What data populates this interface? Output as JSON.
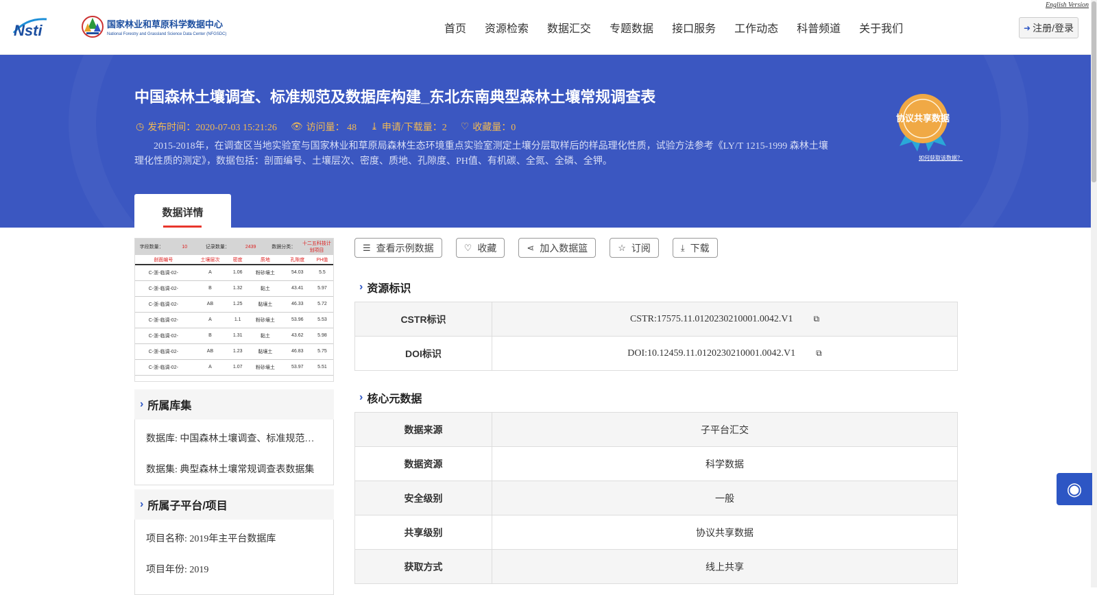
{
  "header": {
    "english_link": "English Version",
    "logo_nsti": "Nsti",
    "logo_center_cn": "国家林业和草原科学数据中心",
    "logo_center_en": "National Forestry and Grassland Science Data Center (NFGSDC)",
    "nav": [
      "首页",
      "资源检索",
      "数据汇交",
      "专题数据",
      "接口服务",
      "工作动态",
      "科普频道",
      "关于我们"
    ],
    "login_label": "注册/登录"
  },
  "banner": {
    "title": "中国森林土壤调查、标准规范及数据库构建_东北东南典型森林土壤常规调查表",
    "publish_time": "发布时间：2020-07-03 15:21:26",
    "visits": "访问量： 48",
    "downloads": "申请/下载量：2",
    "favorites": "收藏量：0",
    "description": "2015-2018年，在调查区当地实验室与国家林业和草原局森林生态环境重点实验室测定土壤分层取样后的样品理化性质，试验方法参考《LY/T 1215-1999 森林土壤理化性质的测定》，数据包括：剖面编号、土壤层次、密度、质地、孔隙度、PH值、有机碳、全氮、全磷、全钾。",
    "badge_text": "协议共享数据",
    "badge_link": "如何获取该数据？",
    "tab_label": "数据详情"
  },
  "sample": {
    "header_cells": [
      "字段数量：",
      "10",
      "记录数量：",
      "2439",
      "数据分类：",
      "十二五科技计划项目"
    ],
    "columns": [
      "剖面编号",
      "土壤层次",
      "密度",
      "质地",
      "孔隙度",
      "PH值"
    ],
    "rows": [
      [
        "C-浙-临调-02-",
        "A",
        "1.06",
        "粉砂壤土",
        "54.03",
        "5.5"
      ],
      [
        "C-浙-临调-02-",
        "B",
        "1.32",
        "黏土",
        "43.41",
        "5.97"
      ],
      [
        "C-浙-临调-02-",
        "AB",
        "1.25",
        "黏壤土",
        "46.33",
        "5.72"
      ],
      [
        "C-浙-临调-02-",
        "A",
        "1.1",
        "粉砂壤土",
        "53.96",
        "5.53"
      ],
      [
        "C-浙-临调-02-",
        "B",
        "1.31",
        "黏土",
        "43.62",
        "5.98"
      ],
      [
        "C-浙-临调-02-",
        "AB",
        "1.23",
        "黏壤土",
        "46.83",
        "5.75"
      ],
      [
        "C-浙-临调-02-",
        "A",
        "1.07",
        "粉砂壤土",
        "53.97",
        "5.51"
      ]
    ]
  },
  "sidebar": {
    "collection_title": "所属库集",
    "database": "数据库: 中国森林土壤调查、标准规范及数据库构建",
    "dataset": "数据集: 典型森林土壤常规调查表数据集",
    "project_title": "所属子平台/项目",
    "project_name": "项目名称: 2019年主平台数据库",
    "project_year": "项目年份: 2019"
  },
  "actions": {
    "sample_label": "查看示例数据",
    "favorite_label": "收藏",
    "basket_label": "加入数据篮",
    "subscribe_label": "订阅",
    "download_label": "下载"
  },
  "identifiers": {
    "title": "资源标识",
    "cstr_key": "CSTR标识",
    "cstr_value": "CSTR:17575.11.0120230210001.0042.V1",
    "doi_key": "DOI标识",
    "doi_value": "DOI:10.12459.11.0120230210001.0042.V1"
  },
  "core_meta": {
    "title": "核心元数据",
    "rows": [
      {
        "key": "数据来源",
        "value": "子平台汇交"
      },
      {
        "key": "数据资源",
        "value": "科学数据"
      },
      {
        "key": "安全级别",
        "value": "一般"
      },
      {
        "key": "共享级别",
        "value": "协议共享数据"
      },
      {
        "key": "获取方式",
        "value": "线上共享"
      }
    ]
  },
  "colors": {
    "banner": "#3b57c1",
    "accent": "#2d56c4",
    "meta_text": "#f0b955",
    "tab_underline": "#e8362c"
  }
}
